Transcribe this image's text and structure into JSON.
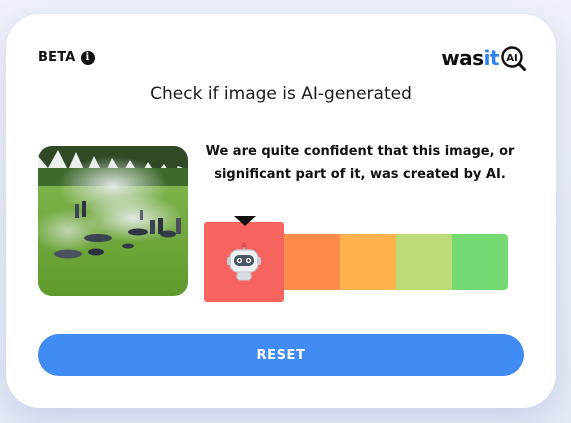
{
  "badge": {
    "label": "BETA",
    "info_icon": "info-icon"
  },
  "logo": {
    "part1": "was",
    "part2": "it",
    "part3": "AI"
  },
  "headline": "Check if image is AI-generated",
  "analyzed_image": {
    "icon": "photo-thumbnail"
  },
  "result": {
    "text": "We are quite confident that this image, or significant part of it, was created by AI.",
    "meter": {
      "segments": 5,
      "active_segment": 1,
      "colors": [
        "#f7635e",
        "#ff8c4b",
        "#ffb14b",
        "#bcdc7a",
        "#76da72"
      ],
      "indicator_icon": "robot-icon"
    }
  },
  "actions": {
    "reset_label": "RESET"
  },
  "colors": {
    "accent": "#418bf5",
    "logo_accent": "#2f7ff5"
  }
}
